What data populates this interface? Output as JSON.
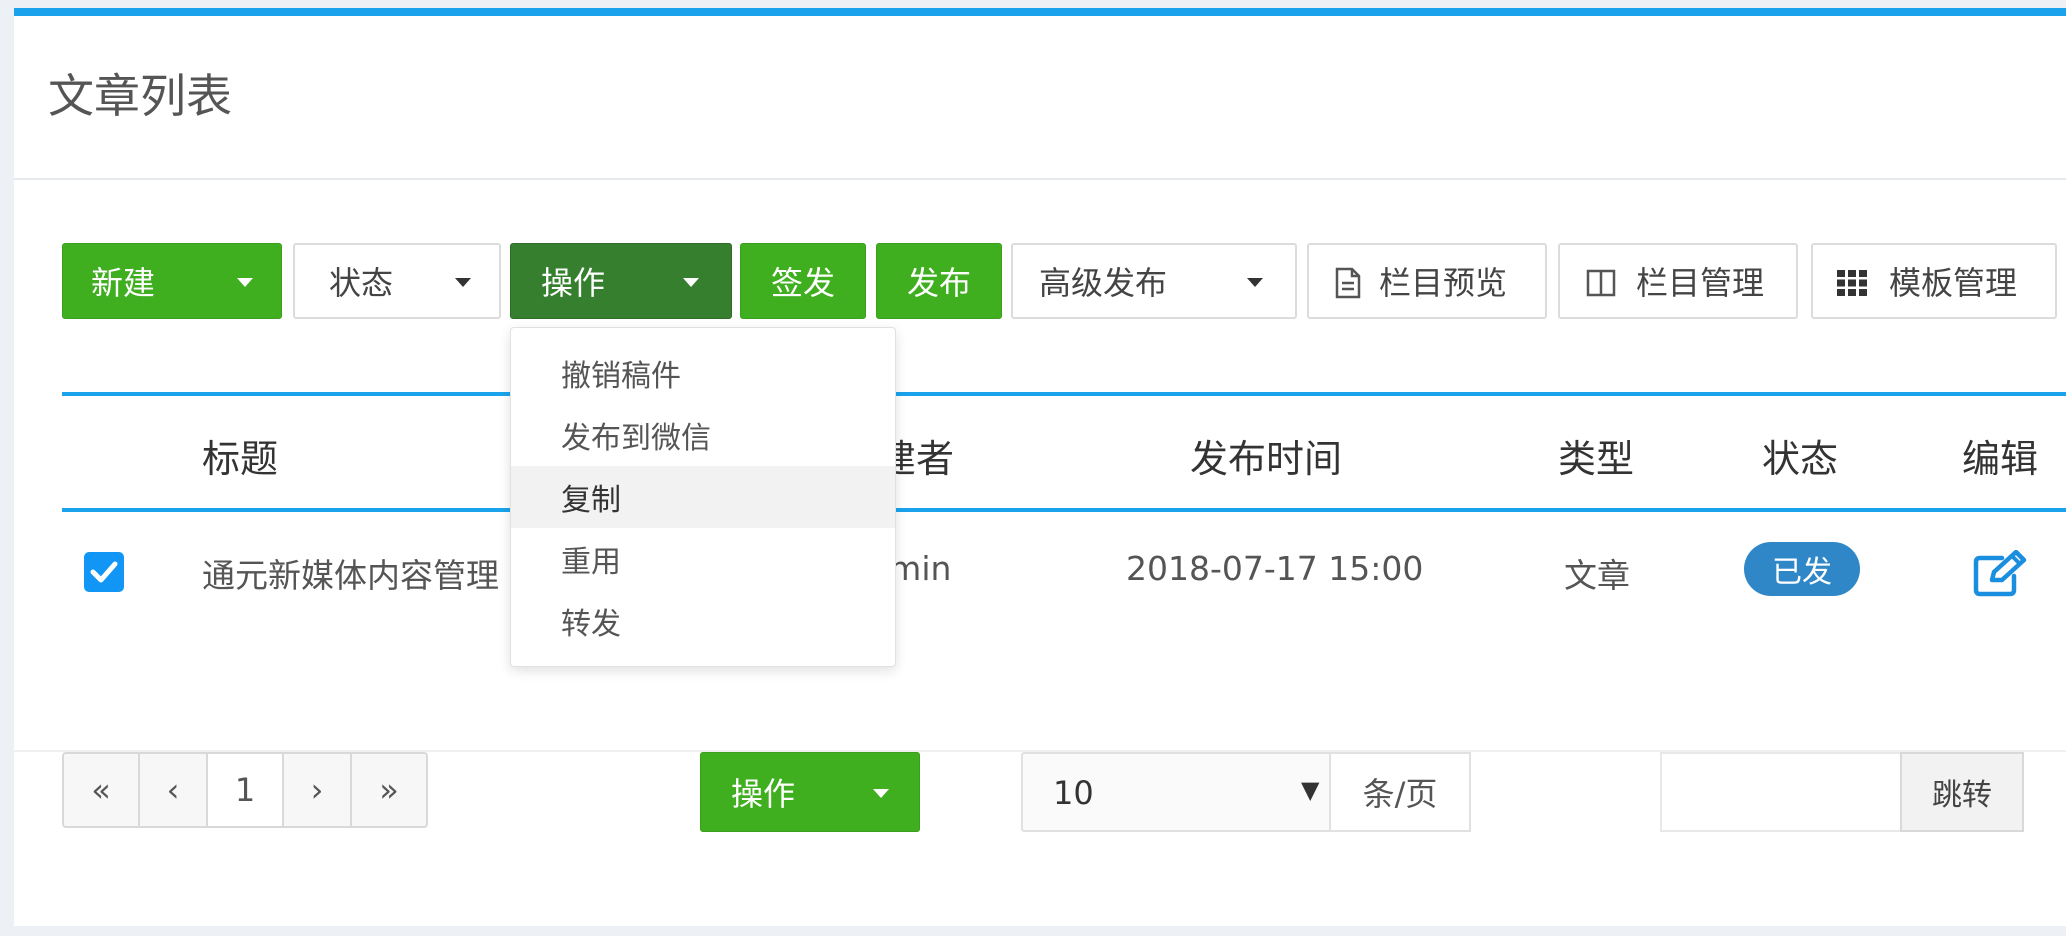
{
  "page": {
    "title": "文章列表"
  },
  "toolbar": {
    "new_label": "新建",
    "status_label": "状态",
    "operate_label": "操作",
    "sign_label": "签发",
    "publish_label": "发布",
    "advanced_publish_label": "高级发布",
    "column_preview_label": "栏目预览",
    "column_manage_label": "栏目管理",
    "template_manage_label": "模板管理"
  },
  "operate_menu": {
    "items": [
      {
        "label": "撤销稿件"
      },
      {
        "label": "发布到微信"
      },
      {
        "label": "复制",
        "hovered": true
      },
      {
        "label": "重用"
      },
      {
        "label": "转发"
      }
    ]
  },
  "table": {
    "headers": {
      "title": "标题",
      "creator": "建者",
      "publish_time": "发布时间",
      "type": "类型",
      "status": "状态",
      "edit": "编辑"
    },
    "rows": [
      {
        "checked": true,
        "title": "通元新媒体内容管理",
        "creator": "lmin",
        "publish_time": "2018-07-17 15:00",
        "type": "文章",
        "status": "已发"
      }
    ]
  },
  "footer": {
    "pager": {
      "first": "«",
      "prev": "‹",
      "current": "1",
      "next": "›",
      "last": "»"
    },
    "operate_label": "操作",
    "page_size": "10",
    "page_size_arrow": "▼",
    "per_page_label": "条/页",
    "jump_label": "跳转"
  },
  "colors": {
    "accent_blue": "#1aa3ec",
    "button_green": "#3fae1f",
    "button_green_active": "#367f2f",
    "status_badge": "#2f87c8",
    "checkbox": "#1296f5"
  }
}
